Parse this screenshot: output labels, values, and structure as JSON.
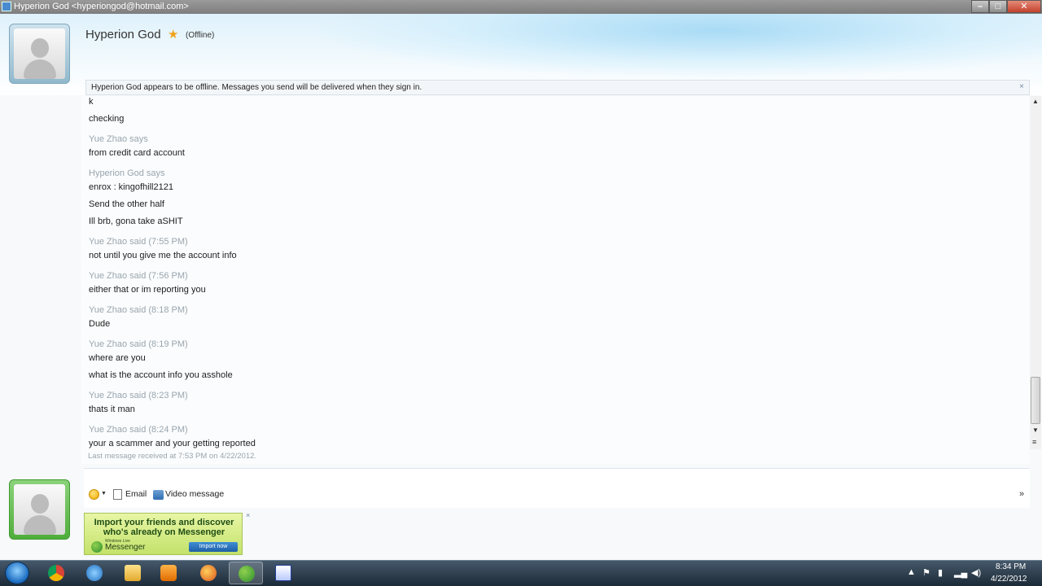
{
  "window": {
    "title": "Hyperion God <hyperiongod@hotmail.com>",
    "controls": {
      "minimize": "–",
      "maximize": "□",
      "close": "✕"
    }
  },
  "contact": {
    "name": "Hyperion God",
    "status": "(Offline)",
    "star": "★"
  },
  "notice": {
    "text": "Hyperion God appears to be offline. Messages you send will be delivered when they sign in.",
    "close": "×"
  },
  "conversation": [
    {
      "kind": "msg",
      "text": "k"
    },
    {
      "kind": "msg",
      "text": "checking"
    },
    {
      "kind": "who",
      "text": "Yue Zhao says"
    },
    {
      "kind": "msg",
      "text": "from credit card account"
    },
    {
      "kind": "who",
      "text": "Hyperion God says"
    },
    {
      "kind": "msg",
      "text": "enrox : kingofhill2121"
    },
    {
      "kind": "msg",
      "text": "Send the other half"
    },
    {
      "kind": "msg",
      "text": "Ill brb, gona take aSHIT"
    },
    {
      "kind": "who",
      "text": "Yue Zhao said (7:55 PM)"
    },
    {
      "kind": "msg",
      "text": "not until you give me the account info"
    },
    {
      "kind": "who",
      "text": "Yue Zhao said (7:56 PM)"
    },
    {
      "kind": "msg",
      "text": "either that or im reporting you"
    },
    {
      "kind": "who",
      "text": "Yue Zhao said (8:18 PM)"
    },
    {
      "kind": "msg",
      "text": "Dude"
    },
    {
      "kind": "who",
      "text": "Yue Zhao said (8:19 PM)"
    },
    {
      "kind": "msg",
      "text": "where are you"
    },
    {
      "kind": "msg",
      "text": "what is the account info you asshole"
    },
    {
      "kind": "who",
      "text": "Yue Zhao said (8:23 PM)"
    },
    {
      "kind": "msg",
      "text": "thats it man"
    },
    {
      "kind": "who",
      "text": "Yue Zhao said (8:24 PM)"
    },
    {
      "kind": "msg",
      "text": "your a scammer and your getting reported"
    }
  ],
  "last_message": "Last message received at 7:53 PM on 4/22/2012.",
  "toolbar": {
    "email_label": "Email",
    "video_label": "Video message",
    "more": "»"
  },
  "ad": {
    "line1": "Import your friends and discover",
    "line2": "who's already on Messenger",
    "brand_sub": "Windows Live",
    "brand": "Messenger",
    "cta": "Import now",
    "close": "×"
  },
  "taskbar": {
    "time": "8:34 PM",
    "date": "4/22/2012"
  },
  "colors": {
    "accent": "#2f6db0",
    "name_gray": "#9aa5ae",
    "taskbar": "#1c2a37",
    "ad_green": "#c3e26a",
    "star": "#f0a21b"
  }
}
